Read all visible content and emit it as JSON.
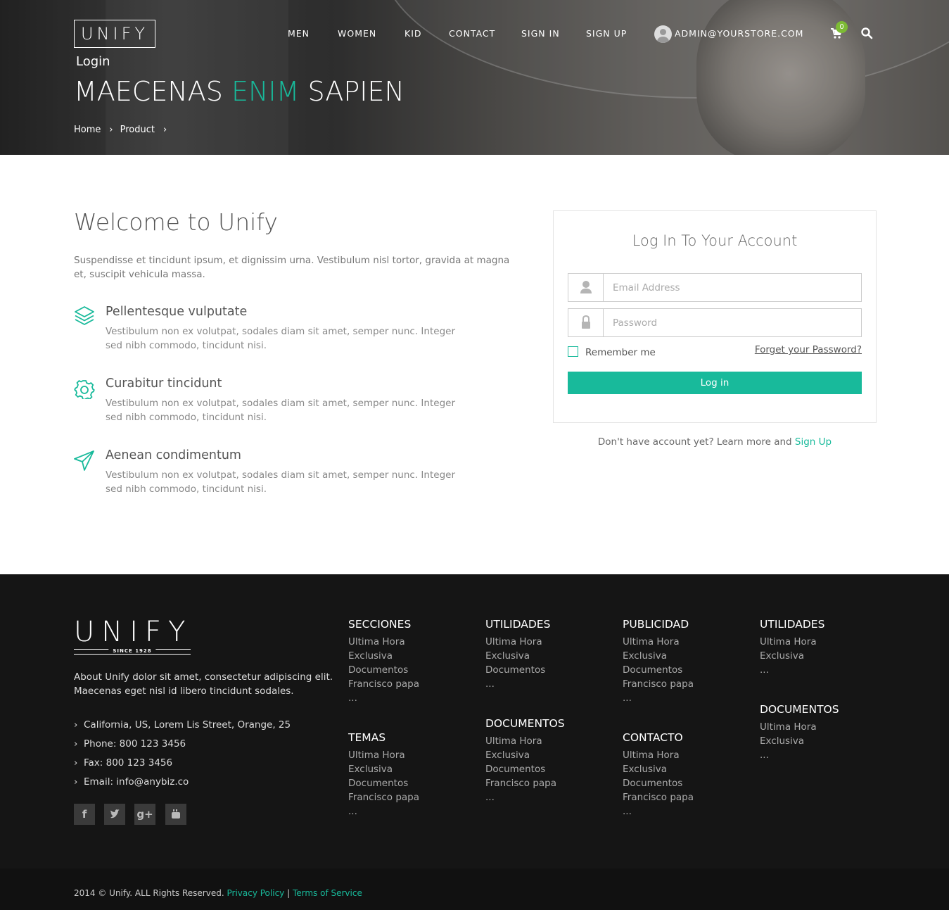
{
  "header": {
    "logo": "UNIFY",
    "nav": [
      "MEN",
      "WOMEN",
      "KID",
      "CONTACT",
      "SIGN IN",
      "SIGN UP"
    ],
    "user_email": "ADMIN@YOURSTORE.COM",
    "cart_count": "0",
    "page_label": "Login",
    "title_start": "MAECENAS",
    "title_accent": "ENIM",
    "title_end": "SAPIEN",
    "breadcrumb": [
      "Home",
      "Product"
    ]
  },
  "main": {
    "welcome_title": "Welcome to Unify",
    "welcome_text": "Suspendisse et tincidunt ipsum, et dignissim urna. Vestibulum nisl tortor, gravida at magna et, suscipit vehicula massa.",
    "features": [
      {
        "title": "Pellentesque vulputate",
        "text": "Vestibulum non ex volutpat, sodales diam sit amet, semper nunc. Integer sed nibh commodo, tincidunt nisi.",
        "icon": "layers-icon"
      },
      {
        "title": "Curabitur tincidunt",
        "text": "Vestibulum non ex volutpat, sodales diam sit amet, semper nunc. Integer sed nibh commodo, tincidunt nisi.",
        "icon": "gear-icon"
      },
      {
        "title": "Aenean condimentum",
        "text": "Vestibulum non ex volutpat, sodales diam sit amet, semper nunc. Integer sed nibh commodo, tincidunt nisi.",
        "icon": "paper-plane-icon"
      }
    ]
  },
  "login": {
    "title": "Log In To Your Account",
    "email_placeholder": "Email Address",
    "password_placeholder": "Password",
    "remember_label": "Remember me",
    "forgot_label": "Forget your Password?",
    "button_label": "Log in",
    "signup_prefix": "Don't have account yet? Learn more and",
    "signup_link": "Sign Up"
  },
  "footer": {
    "logo": "UNIFY",
    "logo_since": "SINCE 1928",
    "about": "About Unify dolor sit amet, consectetur adipiscing elit. Maecenas eget nisl id libero tincidunt sodales.",
    "contact": [
      "California, US, Lorem Lis Street, Orange, 25",
      "Phone: 800 123 3456",
      "Fax: 800 123 3456",
      "Email: info@anybiz.co"
    ],
    "social": [
      "facebook-icon",
      "twitter-icon",
      "google-plus-icon",
      "youtube-icon"
    ],
    "columns": {
      "col1a": {
        "title": "SECCIONES",
        "items": [
          "Ultima Hora",
          "Exclusiva",
          "Documentos",
          "Francisco papa",
          "..."
        ]
      },
      "col1b": {
        "title": "TEMAS",
        "items": [
          "Ultima Hora",
          "Exclusiva",
          "Documentos",
          "Francisco papa",
          "..."
        ]
      },
      "col2a": {
        "title": "UTILIDADES",
        "items": [
          "Ultima Hora",
          "Exclusiva",
          "Documentos",
          "..."
        ]
      },
      "col2b": {
        "title": "DOCUMENTOS",
        "items": [
          "Ultima Hora",
          "Exclusiva",
          "Documentos",
          "Francisco papa",
          "..."
        ]
      },
      "col3a": {
        "title": "PUBLICIDAD",
        "items": [
          "Ultima Hora",
          "Exclusiva",
          "Documentos",
          "Francisco papa",
          "..."
        ]
      },
      "col3b": {
        "title": "CONTACTO",
        "items": [
          "Ultima Hora",
          "Exclusiva",
          "Documentos",
          "Francisco papa",
          "..."
        ]
      },
      "col4a": {
        "title": "UTILIDADES",
        "items": [
          "Ultima Hora",
          "Exclusiva",
          "..."
        ]
      },
      "col4b": {
        "title": "DOCUMENTOS",
        "items": [
          "Ultima Hora",
          "Exclusiva",
          "..."
        ]
      }
    },
    "copyright": "2014 © Unify. ALL Rights Reserved.",
    "privacy": "Privacy Policy",
    "separator": "|",
    "terms": "Terms of Service"
  },
  "colors": {
    "accent": "#18ba9b",
    "footer_bg": "#151515",
    "badge": "#7dbb35"
  }
}
